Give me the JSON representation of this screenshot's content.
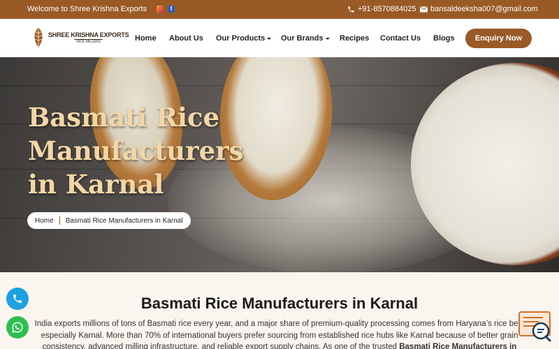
{
  "topbar": {
    "welcome": "Welcome to Shree Krishna Exports",
    "phone": "+91-8570884025",
    "email": "bansaldeeksha007@gmail.com",
    "social_icons": [
      "instagram-icon",
      "facebook-icon"
    ]
  },
  "header": {
    "logo": {
      "brand": "SHREE KRISHNA EXPORTS",
      "sub": "RICE MILLERS"
    },
    "nav": [
      {
        "label": "Home",
        "dropdown": false
      },
      {
        "label": "About Us",
        "dropdown": false
      },
      {
        "label": "Our Products",
        "dropdown": true
      },
      {
        "label": "Our Brands",
        "dropdown": true
      },
      {
        "label": "Recipes",
        "dropdown": false
      },
      {
        "label": "Contact Us",
        "dropdown": false
      },
      {
        "label": "Blogs",
        "dropdown": false
      }
    ],
    "cta": "Enquiry Now"
  },
  "hero": {
    "title": "Basmati Rice Manufacturers in Karnal",
    "breadcrumb": {
      "home": "Home",
      "current": "Basmati Rice Manufacturers in Karnal"
    }
  },
  "content": {
    "heading": "Basmati Rice Manufacturers in Karnal",
    "para_plain": "India exports millions of tons of Basmati rice every year, and a major share of premium-quality processing comes from Haryana’s rice belt, especially Karnal. More than 70% of international buyers prefer sourcing from established rice hubs like Karnal because of better grain consistency, advanced milling infrastructure, and reliable export supply chains. As one of the trusted",
    "para_bold": "Basmati Rice Manufacturers in"
  },
  "colors": {
    "brand_brown": "#9a5a26",
    "hero_title": "#f2d6a6",
    "call_button": "#1ea1e0",
    "whatsapp_button": "#2fbe4f",
    "content_bg": "#fbf5ef"
  },
  "floating": {
    "icons": [
      "phone-icon",
      "whatsapp-icon",
      "chat-icon"
    ]
  }
}
